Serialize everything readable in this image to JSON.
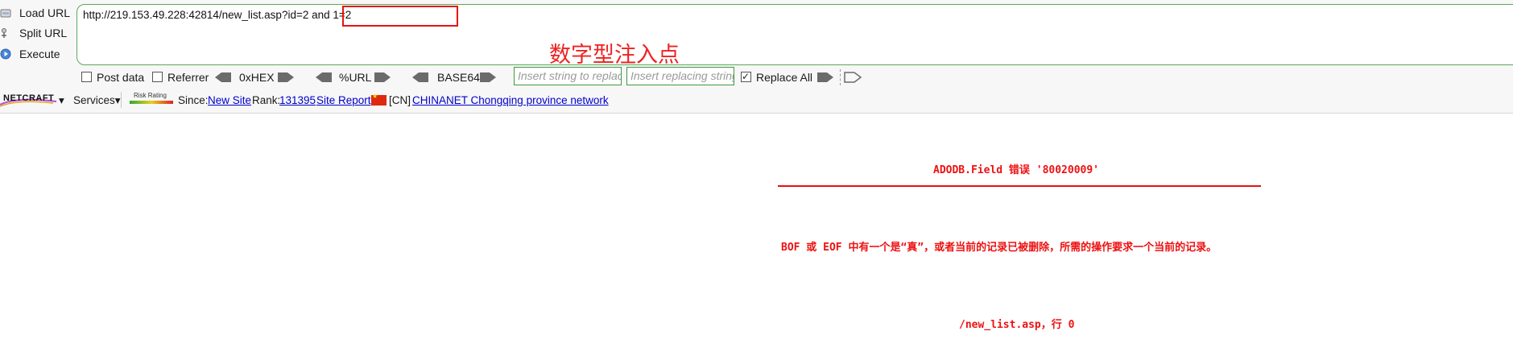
{
  "hackbar": {
    "side_buttons": [
      {
        "label": "Load URL",
        "icon": "load-url-icon"
      },
      {
        "label": "Split URL",
        "icon": "split-url-icon"
      },
      {
        "label": "Execute",
        "icon": "execute-icon"
      }
    ],
    "url_value": "http://219.153.49.228:42814/new_list.asp?id=2 and 1=2",
    "highlighted_part": "?id=2 and 1=2",
    "annotation": "数字型注入点",
    "options": {
      "post_data_label": "Post data",
      "post_data_checked": false,
      "referrer_label": "Referrer",
      "referrer_checked": false,
      "hex_label": "0xHEX",
      "url_label": "%URL",
      "base64_label": "BASE64",
      "replace_find_placeholder": "Insert string to replace",
      "replace_with_placeholder": "Insert replacing string",
      "replace_all_label": "Replace All",
      "replace_all_checked": true
    }
  },
  "netcraft": {
    "logo": "NETCRAFT",
    "services_label": "Services",
    "risk_label": "Risk Rating",
    "since_label": "Since:",
    "since_value": "New Site",
    "rank_label": "Rank:",
    "rank_value": "131395",
    "site_report_label": "Site Report",
    "country_code": "[CN]",
    "network_value": "CHINANET Chongqing province network"
  },
  "page": {
    "error_title": "ADODB.Field 错误 '80020009'",
    "error_message": "BOF 或 EOF 中有一个是“真”，或者当前的记录已被删除，所需的操作要求一个当前的记录。",
    "error_location": "/new_list.asp，行 0"
  },
  "colors": {
    "accent_green": "#3d9a3d",
    "error_red": "#ee1111",
    "link_blue": "#0000cc"
  }
}
